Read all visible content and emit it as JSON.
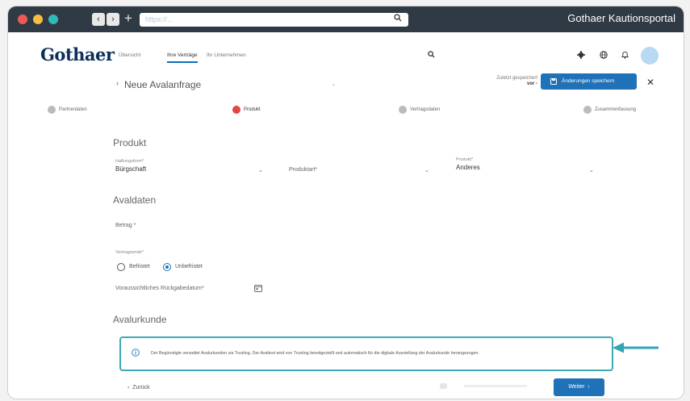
{
  "browser": {
    "url": "https://...",
    "window_title": "Gothaer Kautionsportal"
  },
  "header": {
    "logo": "Gothaer",
    "nav": [
      "Übersicht",
      "Ihre Verträge",
      "Ihr Unternehmen"
    ]
  },
  "page": {
    "title": "Neue Avalanfrage",
    "autosave_label": "Zuletzt gespeichert",
    "autosave_value": "vor -",
    "save_button": "Änderungen speichern"
  },
  "steps": [
    "Partnerdaten",
    "Produkt",
    "Vertragsdaten",
    "Zusammenfassung"
  ],
  "produkt": {
    "section_title": "Produkt",
    "haftungsform_label": "Haftungsform*",
    "haftungsform_value": "Bürgschaft",
    "produktart_placeholder": "Produktart*",
    "produkt_label": "Produkt*",
    "produkt_value": "Anderes"
  },
  "avaldaten": {
    "section_title": "Avaldaten",
    "betrag_placeholder": "Betrag *",
    "vertragsende_label": "Vertragsende*",
    "option_befristet": "Befristet",
    "option_unbefristet": "Unbefristet",
    "rueckgabe_placeholder": "Voraussichtliches Rückgabedatum*"
  },
  "avalurkunde": {
    "section_title": "Avalurkunde",
    "info_text": "Der Begünstigte verwaltet Avalurkunden via Trusting. Der Avaltext wird von Trusting bereitgestellt und automatisch für die digitale Ausstellung der Avalurkunde herangezogen."
  },
  "footer": {
    "back_label": "Zurück",
    "next_label": "Weiter"
  },
  "colors": {
    "brand": "#0b2f58",
    "accent": "#1f72b8",
    "highlight": "#3aaab7",
    "active_step": "#e2473f"
  },
  "icons": [
    "search-icon",
    "gear-icon",
    "globe-icon",
    "bell-icon",
    "save-icon",
    "close-icon",
    "calendar-icon",
    "info-icon",
    "arrow-left-icon"
  ]
}
